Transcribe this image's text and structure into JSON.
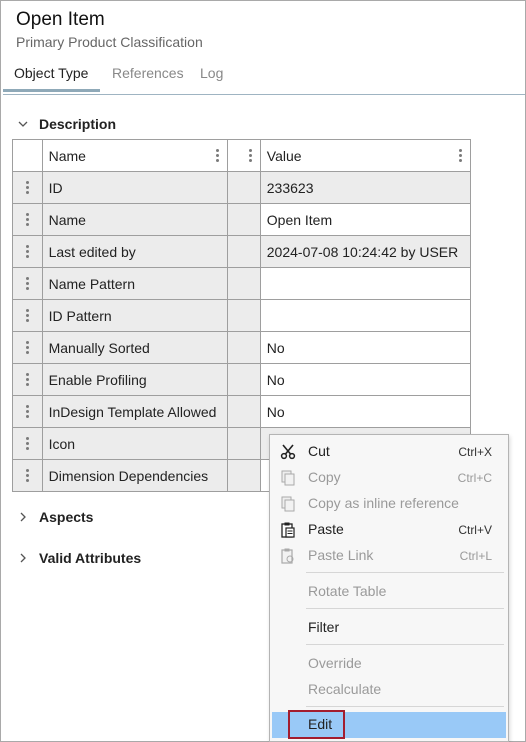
{
  "header": {
    "title": "Open Item",
    "subtitle": "Primary Product Classification"
  },
  "tabs": [
    {
      "label": "Object Type",
      "active": true
    },
    {
      "label": "References",
      "active": false
    },
    {
      "label": "Log",
      "active": false
    }
  ],
  "sections": {
    "description": {
      "label": "Description",
      "expanded": true
    },
    "aspects": {
      "label": "Aspects",
      "expanded": false
    },
    "valid_attributes": {
      "label": "Valid Attributes",
      "expanded": false
    }
  },
  "table": {
    "columns": [
      "Name",
      "Value"
    ],
    "rows": [
      {
        "name": "ID",
        "value": "233623"
      },
      {
        "name": "Name",
        "value": "Open Item"
      },
      {
        "name": "Last edited by",
        "value": "2024-07-08 10:24:42 by USER"
      },
      {
        "name": "Name Pattern",
        "value": ""
      },
      {
        "name": "ID Pattern",
        "value": ""
      },
      {
        "name": "Manually Sorted",
        "value": "No"
      },
      {
        "name": "Enable Profiling",
        "value": "No"
      },
      {
        "name": "InDesign Template Allowed",
        "value": "No"
      },
      {
        "name": "Icon",
        "value": ""
      },
      {
        "name": "Dimension Dependencies",
        "value": ""
      }
    ]
  },
  "context_menu": {
    "items": [
      {
        "label": "Cut",
        "shortcut": "Ctrl+X",
        "icon": "scissors-icon",
        "enabled": true
      },
      {
        "label": "Copy",
        "shortcut": "Ctrl+C",
        "icon": "copy-icon",
        "enabled": false
      },
      {
        "label": "Copy as inline reference",
        "shortcut": "",
        "icon": "copy-reference-icon",
        "enabled": false
      },
      {
        "label": "Paste",
        "shortcut": "Ctrl+V",
        "icon": "paste-icon",
        "enabled": true
      },
      {
        "label": "Paste Link",
        "shortcut": "Ctrl+L",
        "icon": "paste-link-icon",
        "enabled": false
      },
      {
        "label": "Rotate Table",
        "shortcut": "",
        "enabled": false
      },
      {
        "label": "Filter",
        "shortcut": "",
        "enabled": true
      },
      {
        "label": "Override",
        "shortcut": "",
        "enabled": false
      },
      {
        "label": "Recalculate",
        "shortcut": "",
        "enabled": false
      },
      {
        "label": "Edit",
        "shortcut": "",
        "enabled": true,
        "highlighted": true
      }
    ]
  },
  "colors": {
    "menu_highlight": "#99c9f7",
    "edit_outline": "#a31d2f",
    "tab_underline": "#8fa9b8",
    "readonly_cell": "#ececec"
  }
}
